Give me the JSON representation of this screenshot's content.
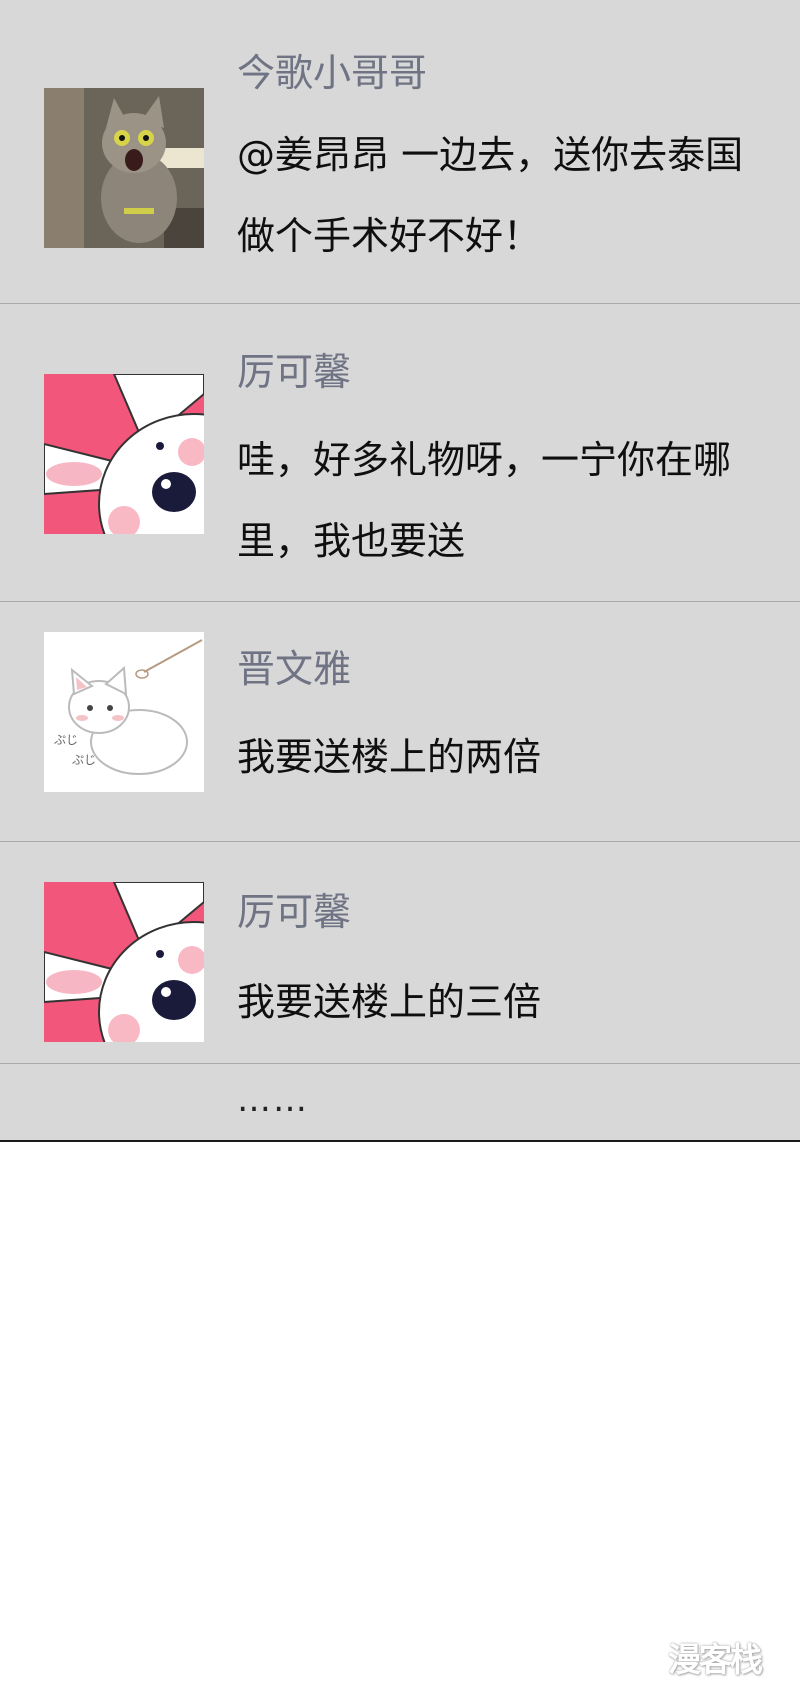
{
  "comments": [
    {
      "username": "今歌小哥哥",
      "message": "@姜昂昂 一边去，送你去泰国做个手术好不好！",
      "avatar": "cat-photo-avatar"
    },
    {
      "username": "厉可馨",
      "message": "哇，好多礼物呀，一宁你在哪里，我也要送",
      "avatar": "pink-bunny-avatar"
    },
    {
      "username": "晋文雅",
      "message": "我要送楼上的两倍",
      "avatar": "white-cat-avatar"
    },
    {
      "username": "厉可馨",
      "message": "我要送楼上的三倍",
      "avatar": "pink-bunny-avatar"
    }
  ],
  "more_indicator": "……",
  "watermark": "漫客栈",
  "colors": {
    "panel_bg": "#d8d8d8",
    "username": "#6f7384",
    "divider": "#a9a9a9",
    "bunny_pink": "#f2567a"
  }
}
